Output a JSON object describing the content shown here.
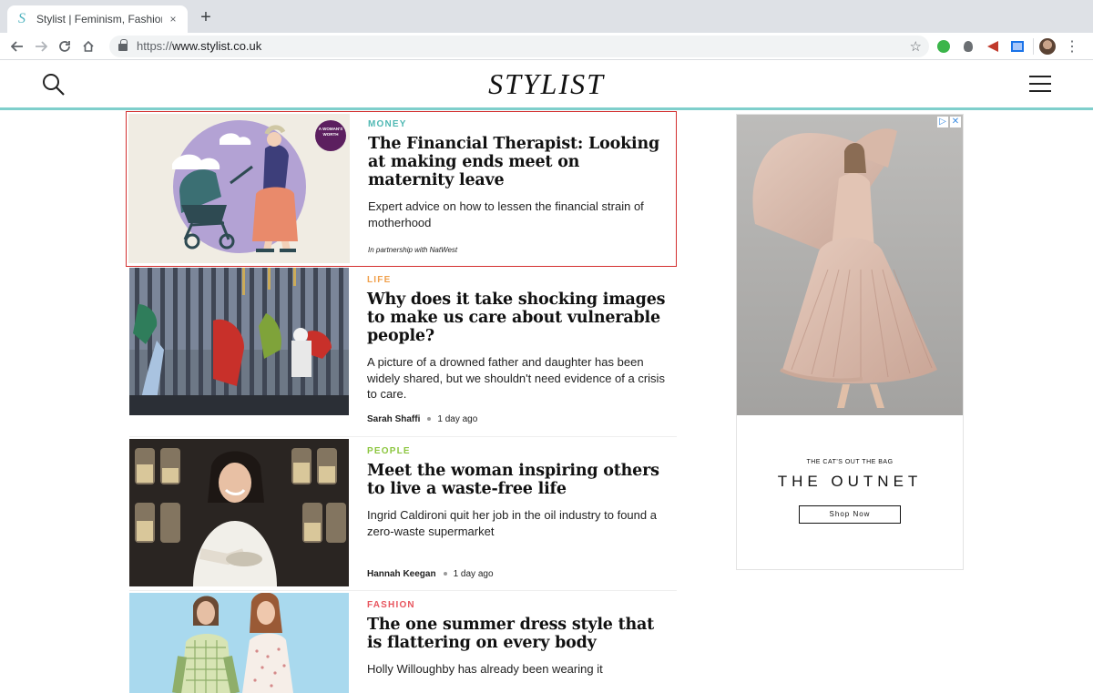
{
  "browser": {
    "tab_title": "Stylist | Feminism, Fashion, Be",
    "tab_close": "×",
    "new_tab": "+",
    "url_scheme": "https://",
    "url_host": "www.stylist.co.uk"
  },
  "site": {
    "logo": "STYLIST",
    "accent_color": "#7fcfcc"
  },
  "articles": [
    {
      "category": "MONEY",
      "category_color": "#4fb8b3",
      "headline": "The Financial Therapist: Looking at making ends meet on maternity leave",
      "standfirst": "Expert advice on how to lessen the financial strain of motherhood",
      "partner": "In partnership with NatWest",
      "badge": "A WOMAN'S WORTH",
      "highlighted": true
    },
    {
      "category": "LIFE",
      "category_color": "#f0a04b",
      "headline": "Why does it take shocking images to make us care about vulnerable people?",
      "standfirst": "A picture of a drowned father and daughter has been widely shared, but we shouldn't need evidence of a crisis to care.",
      "author": "Sarah Shaffi",
      "date": "1 day ago"
    },
    {
      "category": "PEOPLE",
      "category_color": "#8cc63f",
      "headline": "Meet the woman inspiring others to live a waste-free life",
      "standfirst": "Ingrid Caldironi quit her job in the oil industry to found a zero-waste supermarket",
      "author": "Hannah Keegan",
      "date": "1 day ago"
    },
    {
      "category": "FASHION",
      "category_color": "#e8555e",
      "headline": "The one summer dress style that is flattering on every body",
      "standfirst": "Holly Willoughby has already been wearing it"
    }
  ],
  "ad": {
    "tagline": "THE CAT'S OUT THE BAG",
    "brand": "THE OUTNET",
    "cta": "Shop Now",
    "choices_icon": "▷",
    "close_icon": "✕"
  }
}
